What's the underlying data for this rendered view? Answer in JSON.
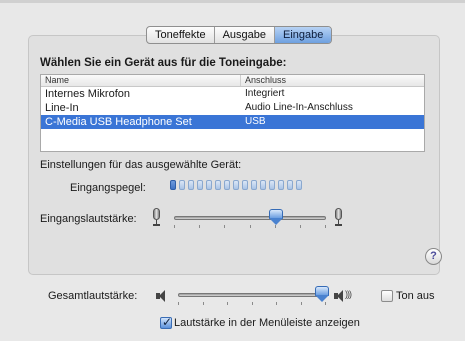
{
  "tabs": [
    {
      "label": "Toneffekte",
      "active": false
    },
    {
      "label": "Ausgabe",
      "active": false
    },
    {
      "label": "Eingabe",
      "active": true
    }
  ],
  "heading": "Wählen Sie ein Gerät aus für die Toneingabe:",
  "table": {
    "columns": [
      "Name",
      "Anschluss"
    ],
    "rows": [
      {
        "name": "Internes Mikrofon",
        "connection": "Integriert",
        "selected": false
      },
      {
        "name": "Line-In",
        "connection": "Audio Line-In-Anschluss",
        "selected": false
      },
      {
        "name": "C-Media USB Headphone Set",
        "connection": "USB",
        "selected": true
      }
    ]
  },
  "settings_label": "Einstellungen für das ausgewählte Gerät:",
  "input_level": {
    "label": "Eingangspegel:",
    "segments": 15,
    "lit": 1
  },
  "input_volume": {
    "label": "Eingangslautstärke:",
    "value": 0.67
  },
  "help_label": "?",
  "master_volume": {
    "label": "Gesamtlautstärke:",
    "value": 0.97
  },
  "mute": {
    "label": "Ton aus",
    "checked": false
  },
  "show_in_menubar": {
    "label": "Lautstärke in der Menüleiste anzeigen",
    "checked": true
  },
  "colors": {
    "accent": "#3a75d6",
    "selection": "#3a75d6",
    "background": "#e8e8e8"
  }
}
